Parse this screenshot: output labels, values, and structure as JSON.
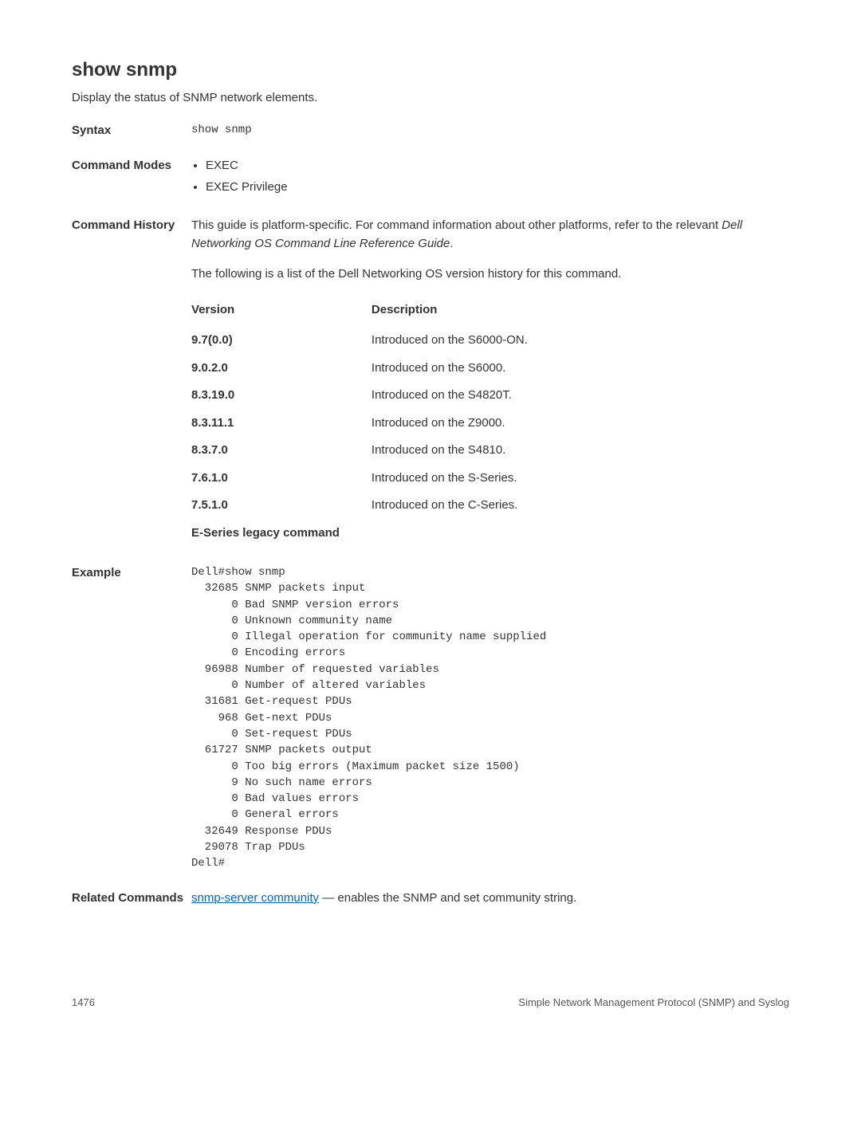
{
  "heading": "show snmp",
  "intro": "Display the status of SNMP network elements.",
  "syntax": {
    "label": "Syntax",
    "value": "show snmp"
  },
  "modes": {
    "label": "Command Modes",
    "items": [
      "EXEC",
      "EXEC Privilege"
    ]
  },
  "history": {
    "label": "Command History",
    "para1_pre": "This guide is platform-specific. For command information about other platforms, refer to the relevant ",
    "para1_italic": "Dell Networking OS Command Line Reference Guide",
    "para1_post": ".",
    "para2": "The following is a list of the Dell Networking OS version history for this command.",
    "col_version": "Version",
    "col_desc": "Description",
    "rows": [
      {
        "v": "9.7(0.0)",
        "d": "Introduced on the S6000-ON."
      },
      {
        "v": "9.0.2.0",
        "d": "Introduced on the S6000."
      },
      {
        "v": "8.3.19.0",
        "d": "Introduced on the S4820T."
      },
      {
        "v": "8.3.11.1",
        "d": "Introduced on the Z9000."
      },
      {
        "v": "8.3.7.0",
        "d": "Introduced on the S4810."
      },
      {
        "v": "7.6.1.0",
        "d": "Introduced on the S-Series."
      },
      {
        "v": "7.5.1.0",
        "d": "Introduced on the C-Series."
      },
      {
        "v": "E-Series legacy command",
        "d": ""
      }
    ]
  },
  "example": {
    "label": "Example",
    "text": "Dell#show snmp\n  32685 SNMP packets input\n      0 Bad SNMP version errors\n      0 Unknown community name\n      0 Illegal operation for community name supplied\n      0 Encoding errors\n  96988 Number of requested variables\n      0 Number of altered variables\n  31681 Get-request PDUs\n    968 Get-next PDUs\n      0 Set-request PDUs\n  61727 SNMP packets output\n      0 Too big errors (Maximum packet size 1500)\n      9 No such name errors\n      0 Bad values errors\n      0 General errors\n  32649 Response PDUs\n  29078 Trap PDUs\nDell#"
  },
  "related": {
    "label": "Related Commands",
    "link_text": "snmp-server community",
    "after": " — enables the SNMP and set community string."
  },
  "footer": {
    "page": "1476",
    "title": "Simple Network Management Protocol (SNMP) and Syslog"
  }
}
